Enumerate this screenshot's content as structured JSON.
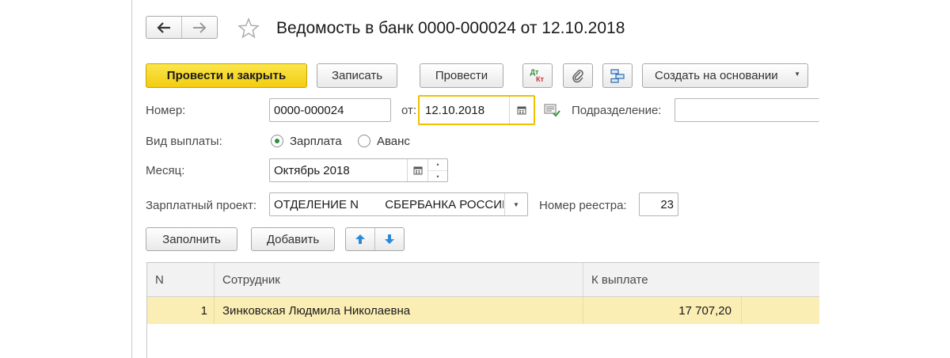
{
  "header": {
    "title": "Ведомость в банк 0000-000024 от 12.10.2018",
    "back_icon": "arrow-left-icon",
    "forward_icon": "arrow-right-icon",
    "favorite_icon": "star-icon"
  },
  "toolbar": {
    "post_and_close": "Провести и закрыть",
    "save": "Записать",
    "post": "Провести",
    "dtkt_top": "Дт",
    "dtkt_bottom": "Кт",
    "create_based_on": "Создать на основании"
  },
  "form": {
    "number_label": "Номер:",
    "number_value": "0000-000024",
    "from_label": "от:",
    "date_value": "12.10.2018",
    "department_label": "Подразделение:",
    "department_value": "",
    "payment_type_label": "Вид выплаты:",
    "payment_type_options": [
      "Зарплата",
      "Аванс"
    ],
    "payment_type_selected": "Зарплата",
    "month_label": "Месяц:",
    "month_value": "Октябрь 2018",
    "salary_project_label": "Зарплатный проект:",
    "salary_project_value": "ОТДЕЛЕНИЕ N        СБЕРБАНКА РОССИИ",
    "registry_number_label": "Номер реестра:",
    "registry_number_value": "23"
  },
  "table_toolbar": {
    "fill": "Заполнить",
    "add": "Добавить"
  },
  "table": {
    "columns": [
      "N",
      "Сотрудник",
      "К выплате"
    ],
    "rows": [
      {
        "n": "1",
        "employee": "Зинковская Людмила Николаевна",
        "amount": "17 707,20"
      }
    ]
  },
  "colors": {
    "primary_button": "#f5d21f",
    "focused_border": "#f0c000",
    "selected_row": "#fbeeb4",
    "arrow_blue": "#2b8ad8"
  }
}
